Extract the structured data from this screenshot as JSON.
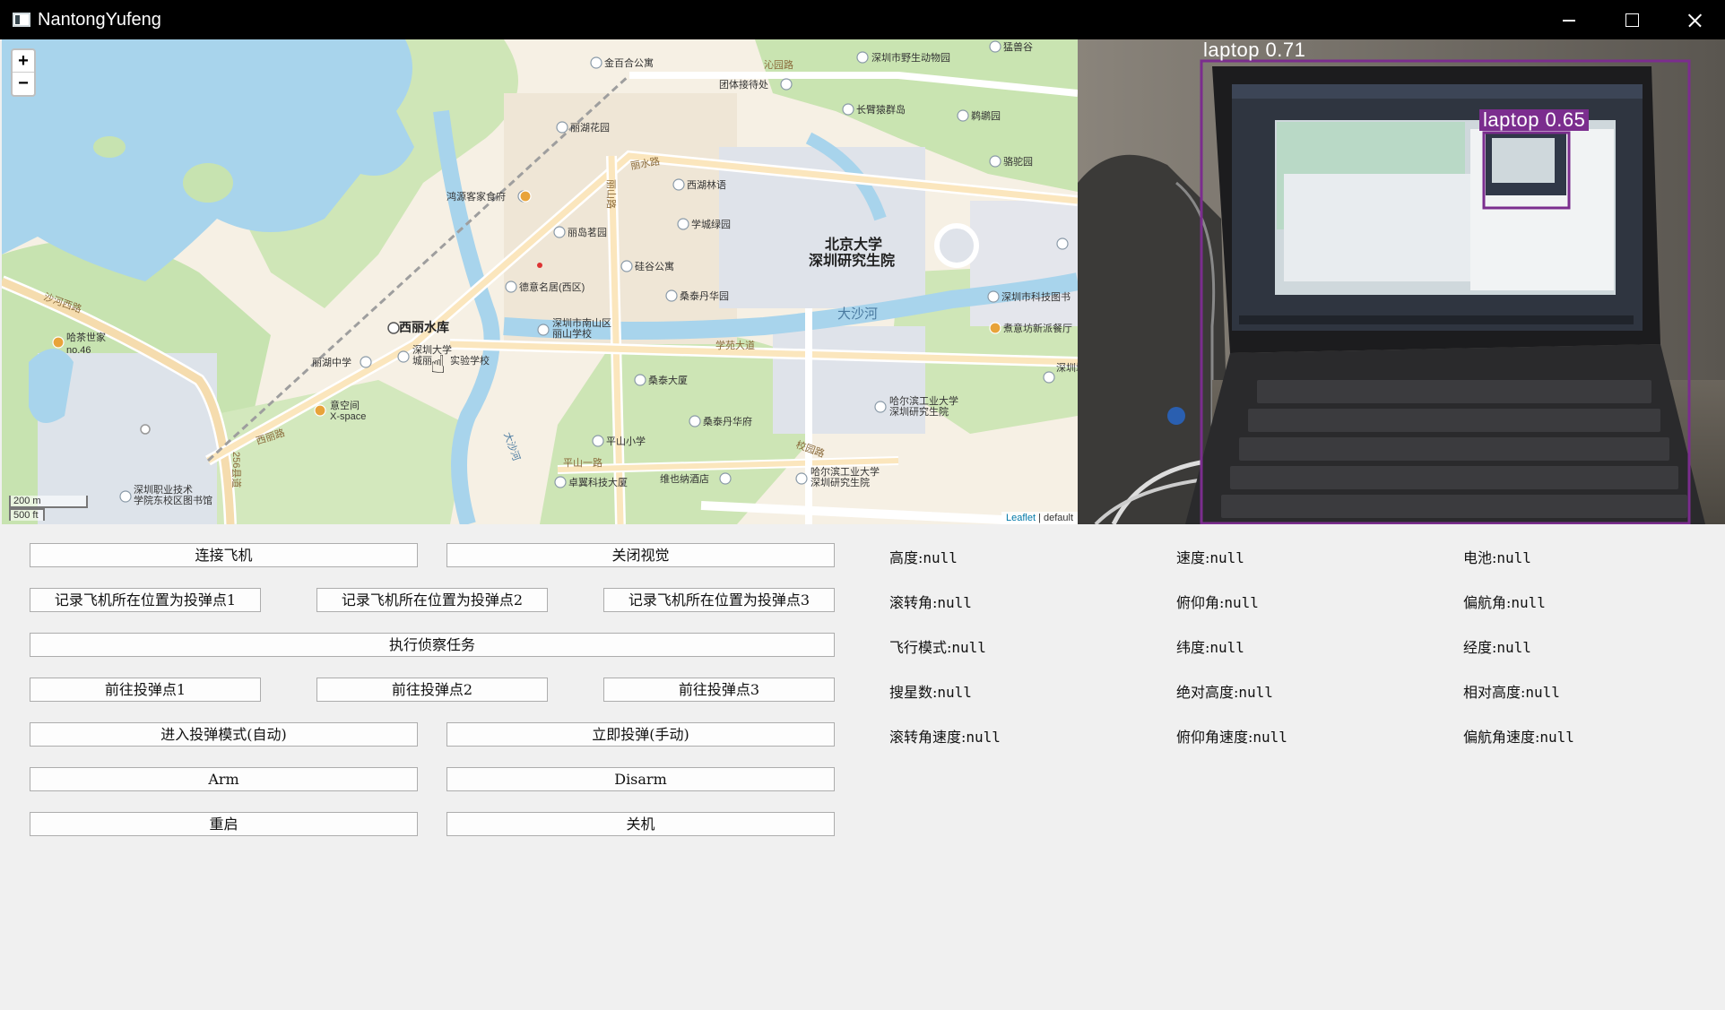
{
  "window": {
    "title": "NantongYufeng"
  },
  "map": {
    "zoom_in": "+",
    "zoom_out": "−",
    "scale_metric": "200 m",
    "scale_imperial": "500 ft",
    "attribution_link": "Leaflet",
    "attribution_rest": " | default",
    "places": {
      "jinbaihe": "金百合公寓",
      "zoo": "深圳市野生动物园",
      "guanlan": "猛兽谷",
      "tuanti": "团体接待处",
      "changbi": "长臂猿群岛",
      "lili": "丽湖花园",
      "yingying": "鹈鹕园",
      "tuotuo": "骆驼园",
      "hongyuan": "鸿源客家食府",
      "xihu": "西湖林语",
      "xuecheng": "学城绿园",
      "lidao": "丽岛茗园",
      "guigu": "硅谷公寓",
      "deyi": "德意名居(西区)",
      "sangtaidan": "桑泰丹华园",
      "pku1": "北京大学",
      "pku2": "深圳研究生院",
      "reservoir": "西丽水库",
      "hachashijia": "哈茶世家",
      "no46": "no.46",
      "lihu_ms": "丽湖中学",
      "szu1": "深圳大学",
      "szu2": "城丽",
      "szu3": "实验学校",
      "nanshan1": "深圳市南山区",
      "nanshan2": "丽山学校",
      "dashahe": "大沙河",
      "kejitushu": "深圳市科技图书",
      "zhuyixian": "煮意坊新派餐厅",
      "sangtaidasha": "桑泰大厦",
      "sangtaihua": "桑泰丹华府",
      "hit1": "哈尔滨工业大学",
      "hit2": "深圳研究生院",
      "yikongjian": "意空间",
      "xspace": "X-space",
      "pingshan": "平山小学",
      "zhuoyi": "卓翼科技大厦",
      "weiye": "维也纳酒店",
      "hit3": "哈尔滨工业大学",
      "hit4": "深圳研究生院",
      "vocational1": "深圳职业技术",
      "vocational2": "学院东校区图书馆",
      "road_shahe": "沙河西路",
      "road_xili": "西丽路",
      "road_256": "256县道",
      "road_lishui": "丽水路",
      "road_lishan": "丽山路",
      "road_xueyuan": "学苑大道",
      "road_pingshan": "平山一路",
      "road_qinyuan": "沁园路",
      "road_xiaoyuan": "校园路",
      "road_dashahe": "大沙河",
      "road_shenzhen": "深圳城"
    }
  },
  "camera": {
    "detections": [
      {
        "label": "laptop 0.71"
      },
      {
        "label": "laptop 0.65"
      }
    ],
    "colors": {
      "box": "#7b2d8e",
      "box_label_bg": "#7b2d8e"
    }
  },
  "controls": {
    "connect": "连接飞机",
    "close_vision": "关闭视觉",
    "record1": "记录飞机所在位置为投弹点1",
    "record2": "记录飞机所在位置为投弹点2",
    "record3": "记录飞机所在位置为投弹点3",
    "recon": "执行侦察任务",
    "goto1": "前往投弹点1",
    "goto2": "前往投弹点2",
    "goto3": "前往投弹点3",
    "drop_auto": "进入投弹模式(自动)",
    "drop_manual": "立即投弹(手动)",
    "arm": "Arm",
    "disarm": "Disarm",
    "reboot": "重启",
    "shutdown": "关机"
  },
  "telemetry": [
    {
      "label": "高度:",
      "value": "null"
    },
    {
      "label": "速度:",
      "value": "null"
    },
    {
      "label": "电池:",
      "value": "null"
    },
    {
      "label": "滚转角:",
      "value": "null"
    },
    {
      "label": "俯仰角:",
      "value": "null"
    },
    {
      "label": "偏航角:",
      "value": "null"
    },
    {
      "label": "飞行模式:",
      "value": "null"
    },
    {
      "label": "纬度:",
      "value": "null"
    },
    {
      "label": "经度:",
      "value": "null"
    },
    {
      "label": "搜星数:",
      "value": "null"
    },
    {
      "label": "绝对高度:",
      "value": "null"
    },
    {
      "label": "相对高度:",
      "value": "null"
    },
    {
      "label": "滚转角速度:",
      "value": "null"
    },
    {
      "label": "俯仰角速度:",
      "value": "null"
    },
    {
      "label": "偏航角速度:",
      "value": "null"
    }
  ]
}
